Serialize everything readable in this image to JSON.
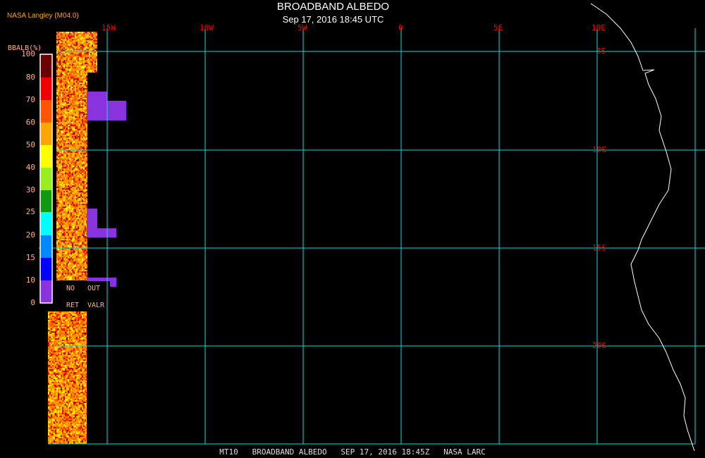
{
  "header": {
    "title": "BROADBAND ALBEDO",
    "subtitle": "Sep 17, 2016 18:45 UTC",
    "source": "NASA Langley (M04.0)"
  },
  "legend": {
    "unit": "BBALB(%)",
    "ticks": [
      "100",
      "80",
      "70",
      "60",
      "50",
      "40",
      "30",
      "25",
      "20",
      "15",
      "10",
      "0"
    ],
    "colors": [
      "#6b0000",
      "#ee0000",
      "#ff5500",
      "#ffa500",
      "#ffff00",
      "#99ee22",
      "#119911",
      "#00ffff",
      "#0088ff",
      "#0000ff",
      "#8833dd"
    ],
    "no_ret": [
      "NO",
      "RET"
    ],
    "out_valr": [
      "OUT",
      "VALR"
    ]
  },
  "grid": {
    "lon_labels": [
      "15W",
      "10W",
      "5W",
      "0",
      "5E",
      "10E"
    ],
    "lat_labels": [
      "5S",
      "10S",
      "15S",
      "20S"
    ],
    "line_color": "#00e0e0",
    "label_color": "#ff0000"
  },
  "footer": "MT10   BROADBAND ALBEDO   SEP 17, 2016 18:45Z   NASA LARC"
}
